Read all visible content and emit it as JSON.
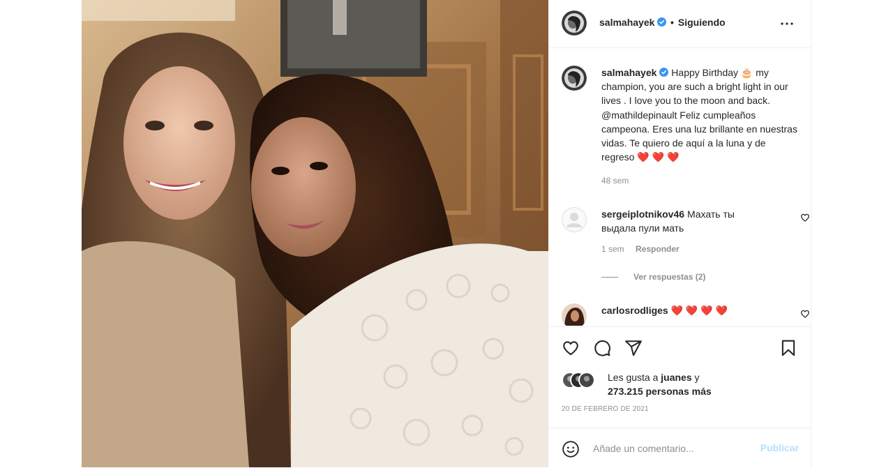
{
  "post": {
    "username": "salmahayek",
    "separator": "•",
    "follow_status": "Siguiendo",
    "more_icon": "more-options-icon"
  },
  "caption": {
    "username": "salmahayek",
    "text": "Happy Birthday 🎂 my champion, you are such a bright light in our lives . I love you to the moon and back. @mathildepinault Feliz cumpleaños campeona. Eres una luz brillante en nuestras vidas. Te quiero de aquí a la luna y de regreso",
    "hearts": "❤️ ❤️ ❤️",
    "time": "48 sem"
  },
  "comments": [
    {
      "username": "sergeiplotnikov46",
      "text": "Махать ты выдала пули мать",
      "time": "1 sem",
      "reply_label": "Responder",
      "view_replies": "Ver respuestas (2)"
    },
    {
      "username": "carlosrodliges",
      "text": "❤️ ❤️ ❤️ ❤️"
    }
  ],
  "likes": {
    "prefix": "Les gusta a",
    "liked_by": "juanes",
    "suffix": "y",
    "others": "273.215 personas más"
  },
  "date": "20 DE FEBRERO DE 2021",
  "comment_box": {
    "placeholder": "Añade un comentario...",
    "publish_label": "Publicar"
  },
  "colors": {
    "verified": "#3897f0",
    "publish_disabled": "#b2dffc",
    "muted_text": "#8e8e8e",
    "heart_red": "#ed1b2e"
  }
}
